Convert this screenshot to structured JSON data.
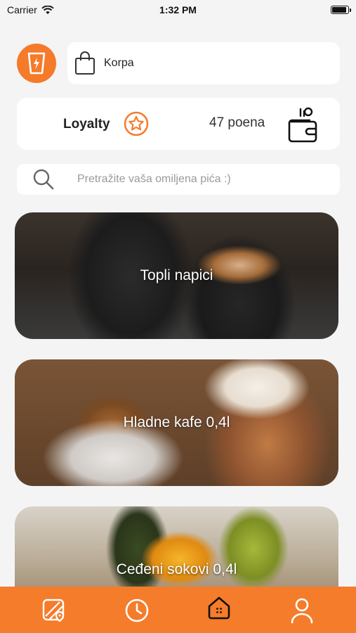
{
  "status_bar": {
    "carrier": "Carrier",
    "time": "1:32 PM"
  },
  "header": {
    "cart_label": "Korpa"
  },
  "loyalty": {
    "title": "Loyalty",
    "points": "47 poena"
  },
  "search": {
    "placeholder": "Pretražite vaša omiljena pića :)"
  },
  "categories": [
    {
      "label": "Topli napici"
    },
    {
      "label": "Hladne kafe 0,4l"
    },
    {
      "label": "Ceđeni sokovi 0,4l"
    }
  ],
  "bottom_nav": {
    "items": [
      {
        "icon": "map-icon"
      },
      {
        "icon": "clock-icon"
      },
      {
        "icon": "home-icon",
        "active": true
      },
      {
        "icon": "profile-icon"
      }
    ]
  },
  "colors": {
    "accent": "#f47c2b",
    "background": "#f4f4f4",
    "card": "#ffffff"
  }
}
